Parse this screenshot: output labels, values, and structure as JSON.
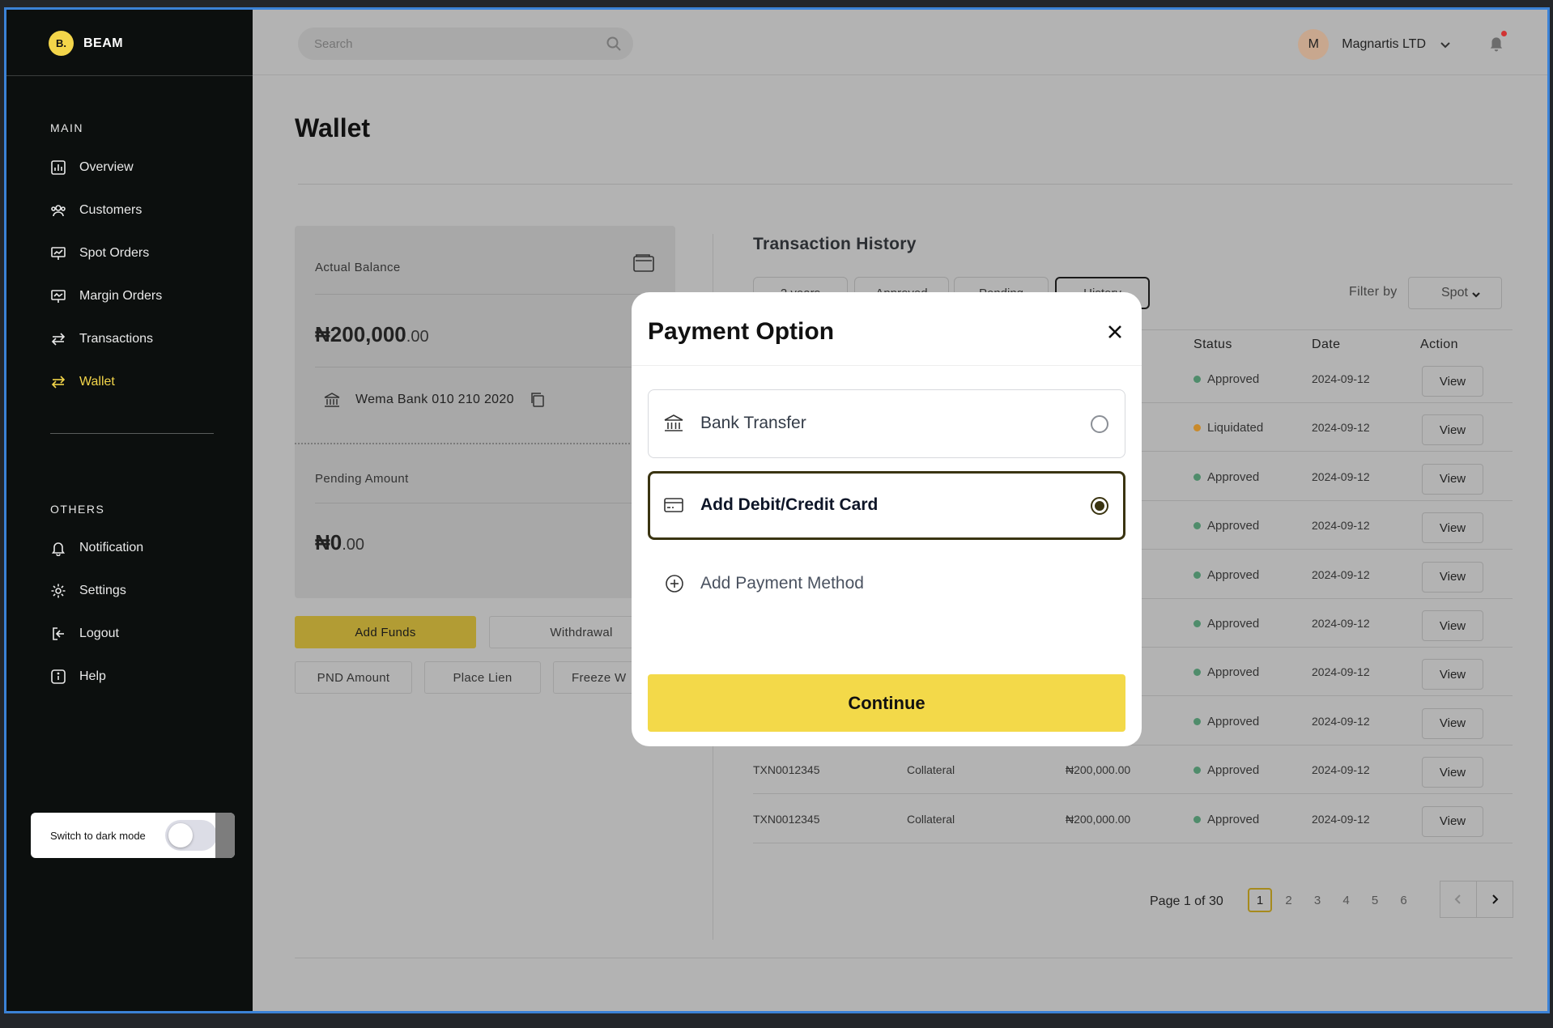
{
  "brand": {
    "logo_text": "B.",
    "name": "BEAM"
  },
  "sidebar": {
    "main_label": "MAIN",
    "main_items": [
      {
        "label": "Overview",
        "icon": "chart-icon",
        "active": false
      },
      {
        "label": "Customers",
        "icon": "users-icon",
        "active": false
      },
      {
        "label": "Spot Orders",
        "icon": "presentation-icon",
        "active": false
      },
      {
        "label": "Margin Orders",
        "icon": "presentation-chart-icon",
        "active": false
      },
      {
        "label": "Transactions",
        "icon": "arrows-swap-icon",
        "active": false
      },
      {
        "label": "Wallet",
        "icon": "arrows-swap-icon",
        "active": true
      }
    ],
    "others_label": "OTHERS",
    "other_items": [
      {
        "label": "Notification",
        "icon": "bell-icon"
      },
      {
        "label": "Settings",
        "icon": "gear-icon"
      },
      {
        "label": "Logout",
        "icon": "logout-icon"
      },
      {
        "label": "Help",
        "icon": "info-icon"
      }
    ],
    "dark_mode_label": "Switch to dark mode",
    "dark_mode_on": false
  },
  "topbar": {
    "search_placeholder": "Search",
    "user_initial": "M",
    "user_name": "Magnartis LTD"
  },
  "page": {
    "title": "Wallet"
  },
  "balance": {
    "actual_label": "Actual Balance",
    "actual_whole": "₦200,000",
    "actual_decimal": ".00",
    "bank_info": "Wema Bank 010 210 2020",
    "pending_label": "Pending Amount",
    "pending_whole": "₦0",
    "pending_decimal": ".00"
  },
  "actions": {
    "add_funds": "Add Funds",
    "withdrawal": "Withdrawal",
    "pnd_amount": "PND Amount",
    "place_lien": "Place Lien",
    "freeze": "Freeze W"
  },
  "transactions": {
    "title": "Transaction History",
    "tabs": [
      "2 years",
      "Approved",
      "Pending",
      "History"
    ],
    "active_tab": "History",
    "filter_label": "Filter by",
    "filter_value": "Spot",
    "columns": {
      "status": "Status",
      "date": "Date",
      "action": "Action"
    },
    "rows": [
      {
        "id": "",
        "type": "",
        "amount": "",
        "status": "Approved",
        "date": "2024-09-12",
        "action": "View"
      },
      {
        "id": "",
        "type": "",
        "amount": "",
        "status": "Liquidated",
        "date": "2024-09-12",
        "action": "View"
      },
      {
        "id": "",
        "type": "",
        "amount": "",
        "status": "Approved",
        "date": "2024-09-12",
        "action": "View"
      },
      {
        "id": "",
        "type": "",
        "amount": "",
        "status": "Approved",
        "date": "2024-09-12",
        "action": "View"
      },
      {
        "id": "",
        "type": "",
        "amount": "",
        "status": "Approved",
        "date": "2024-09-12",
        "action": "View"
      },
      {
        "id": "",
        "type": "",
        "amount": "",
        "status": "Approved",
        "date": "2024-09-12",
        "action": "View"
      },
      {
        "id": "",
        "type": "",
        "amount": "",
        "status": "Approved",
        "date": "2024-09-12",
        "action": "View"
      },
      {
        "id": "",
        "type": "",
        "amount": "",
        "status": "Approved",
        "date": "2024-09-12",
        "action": "View"
      },
      {
        "id": "TXN0012345",
        "type": "Collateral",
        "amount": "₦200,000.00",
        "status": "Approved",
        "date": "2024-09-12",
        "action": "View"
      },
      {
        "id": "TXN0012345",
        "type": "Collateral",
        "amount": "₦200,000.00",
        "status": "Approved",
        "date": "2024-09-12",
        "action": "View"
      }
    ],
    "status_colors": {
      "Approved": "#4f8c6b",
      "Liquidated": "#c98a2b"
    },
    "pagination": {
      "info": "Page 1 of 30",
      "pages": [
        "1",
        "2",
        "3",
        "4",
        "5",
        "6"
      ],
      "current": "1"
    }
  },
  "modal": {
    "title": "Payment Option",
    "options": [
      {
        "label": "Bank Transfer",
        "icon": "bank-icon",
        "selected": false
      },
      {
        "label": "Add Debit/Credit Card",
        "icon": "credit-card-icon",
        "selected": true
      }
    ],
    "add_method": "Add Payment Method",
    "continue": "Continue"
  },
  "colors": {
    "accent": "#f3d949",
    "sidebar_bg": "#0c0f0e",
    "active_nav": "#f3d54a"
  }
}
